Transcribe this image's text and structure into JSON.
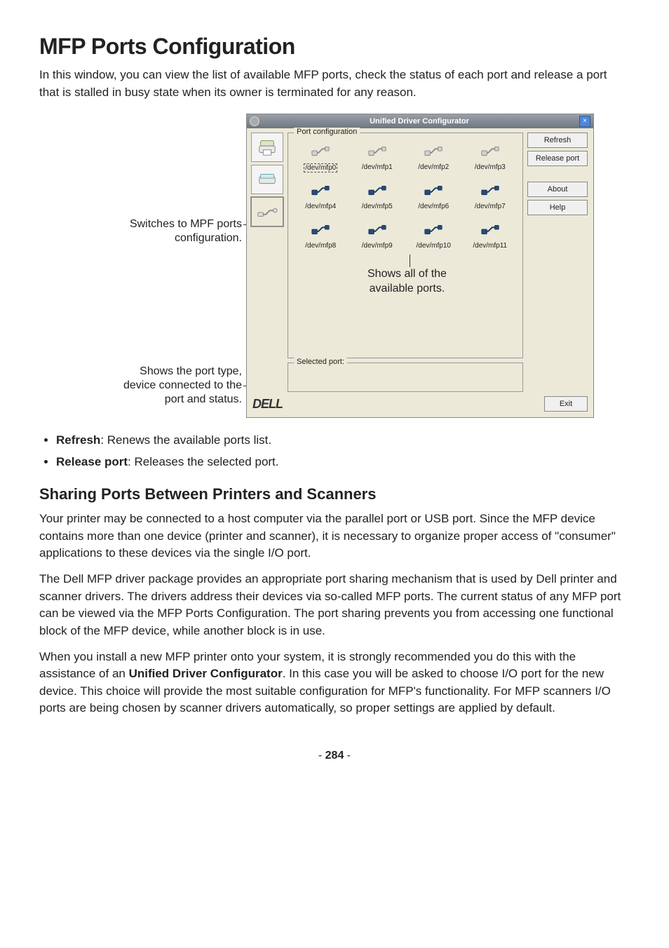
{
  "page": {
    "number": "284",
    "dash": "- ",
    "dash2": " -"
  },
  "headings": {
    "main": "MFP Ports Configuration",
    "sub1": "Sharing Ports Between Printers and Scanners"
  },
  "intro": "In this window, you can view the list of available MFP ports, check the status of each port and release a port that is stalled in busy state when its owner is terminated for any reason.",
  "labels": {
    "switch_l1": "Switches to MPF ports",
    "switch_l2": "configuration.",
    "avail_l1": "Shows all of the",
    "avail_l2": "available ports.",
    "porttype_l1": "Shows the port type,",
    "porttype_l2": "device connected to the",
    "porttype_l3": "port and status."
  },
  "window": {
    "title": "Unified Driver Configurator",
    "group_legend": "Port configuration",
    "selected_legend": "Selected port:",
    "close_glyph": "×",
    "logo": "DELL",
    "buttons": {
      "refresh": "Refresh",
      "release": "Release port",
      "about": "About",
      "help": "Help",
      "exit": "Exit"
    },
    "ports": [
      "/dev/mfp0",
      "/dev/mfp1",
      "/dev/mfp2",
      "/dev/mfp3",
      "/dev/mfp4",
      "/dev/mfp5",
      "/dev/mfp6",
      "/dev/mfp7",
      "/dev/mfp8",
      "/dev/mfp9",
      "/dev/mfp10",
      "/dev/mfp11"
    ]
  },
  "bullets": {
    "b1_term": "Refresh",
    "b1_rest": ": Renews the available ports list.",
    "b2_term": "Release port",
    "b2_rest": ": Releases the selected port."
  },
  "paras": {
    "p1": "Your printer may be connected to a host computer via the parallel port or USB port. Since the MFP device contains more than one device (printer and scanner), it is necessary to organize proper access of \"consumer\" applications to these devices via the single I/O port.",
    "p2": "The Dell MFP driver package provides an appropriate port sharing mechanism that is used by Dell printer and scanner drivers. The drivers address their devices via so-called MFP ports. The current status of any MFP port can be viewed via the MFP Ports Configuration. The port sharing prevents you from accessing one functional block of the MFP device, while another block is in use.",
    "p3a": "When you install a new MFP printer onto your system, it is strongly recommended you do this with the assistance of an ",
    "p3b": "Unified Driver Configurator",
    "p3c": ". In this case you will be asked to choose I/O port for the new device. This choice will provide the most suitable configuration for MFP's functionality. For MFP scanners I/O ports are being chosen by scanner drivers automatically, so proper settings are applied by default."
  }
}
